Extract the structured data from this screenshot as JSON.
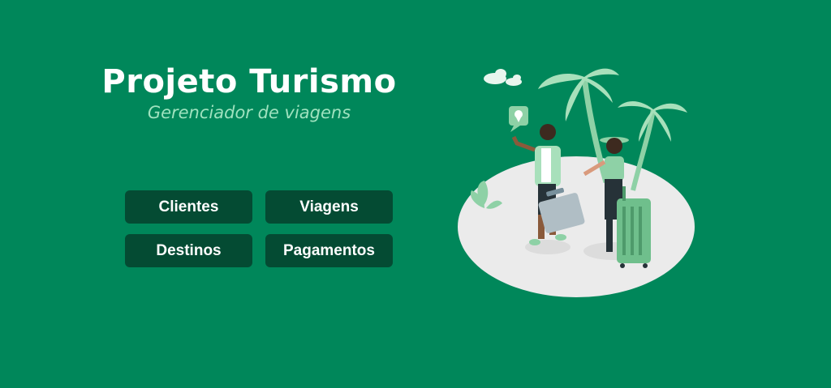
{
  "header": {
    "title": "Projeto Turismo",
    "subtitle": "Gerenciador de viagens"
  },
  "menu": {
    "clientes": "Clientes",
    "viagens": "Viagens",
    "destinos": "Destinos",
    "pagamentos": "Pagamentos"
  },
  "colors": {
    "background": "#00875a",
    "button": "#044b33",
    "subtitle": "#9fe2bf"
  },
  "illustration": {
    "icons": [
      "cloud-icon",
      "palm-tree-icon",
      "location-pin-icon",
      "suitcase-icon"
    ]
  }
}
